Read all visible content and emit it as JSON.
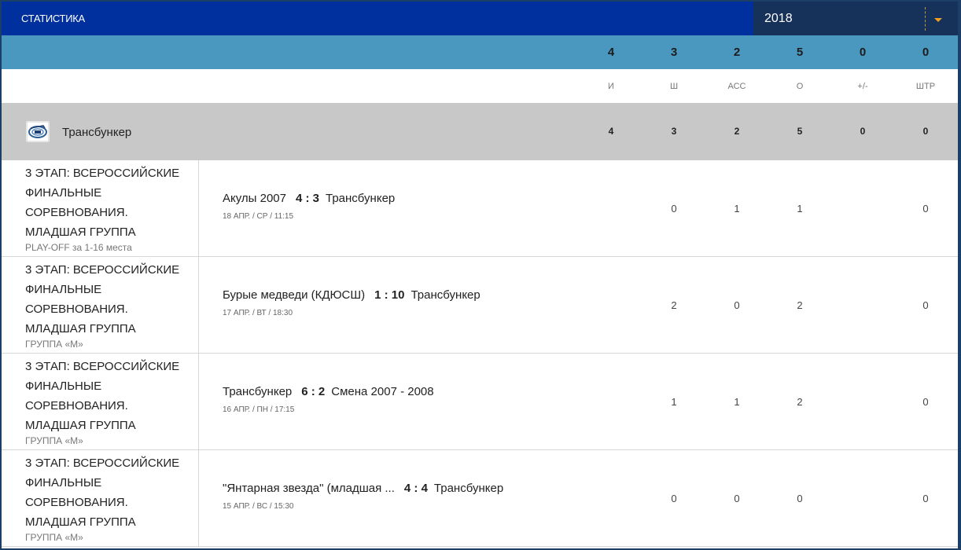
{
  "header": {
    "title": "СТАТИСТИКА",
    "year": "2018"
  },
  "totals": [
    "4",
    "3",
    "2",
    "5",
    "0",
    "0"
  ],
  "columns": [
    "И",
    "Ш",
    "АСС",
    "О",
    "+/-",
    "ШТР"
  ],
  "team": {
    "name": "Трансбункер",
    "stats": [
      "4",
      "3",
      "2",
      "5",
      "0",
      "0"
    ]
  },
  "games": [
    {
      "stage": "3 ЭТАП: ВСЕРОССИЙСКИЕ ФИНАЛЬНЫЕ СОРЕВНОВАНИЯ. МЛАДШАЯ ГРУППА",
      "sub": "PLAY-OFF за 1-16 места",
      "home": "Акулы 2007",
      "score": "4 : 3",
      "away": "Трансбункер",
      "date": "18 АПР. / СР / 11:15",
      "stats": [
        "",
        "0",
        "1",
        "1",
        "",
        "0"
      ]
    },
    {
      "stage": "3 ЭТАП: ВСЕРОССИЙСКИЕ ФИНАЛЬНЫЕ СОРЕВНОВАНИЯ. МЛАДШАЯ ГРУППА",
      "sub": "ГРУППА «М»",
      "home": "Бурые медведи (КДЮСШ)",
      "score": "1 : 10",
      "away": "Трансбункер",
      "date": "17 АПР. / ВТ / 18:30",
      "stats": [
        "",
        "2",
        "0",
        "2",
        "",
        "0"
      ]
    },
    {
      "stage": "3 ЭТАП: ВСЕРОССИЙСКИЕ ФИНАЛЬНЫЕ СОРЕВНОВАНИЯ. МЛАДШАЯ ГРУППА",
      "sub": "ГРУППА «М»",
      "home": "Трансбункер",
      "score": "6 : 2",
      "away": "Смена 2007 - 2008",
      "date": "16 АПР. / ПН / 17:15",
      "stats": [
        "",
        "1",
        "1",
        "2",
        "",
        "0"
      ]
    },
    {
      "stage": "3 ЭТАП: ВСЕРОССИЙСКИЕ ФИНАЛЬНЫЕ СОРЕВНОВАНИЯ. МЛАДШАЯ ГРУППА",
      "sub": "ГРУППА «М»",
      "home": "\"Янтарная звезда\" (младшая ...",
      "score": "4 : 4",
      "away": "Трансбункер",
      "date": "15 АПР. / ВС / 15:30",
      "stats": [
        "",
        "0",
        "0",
        "0",
        "",
        "0"
      ]
    }
  ]
}
